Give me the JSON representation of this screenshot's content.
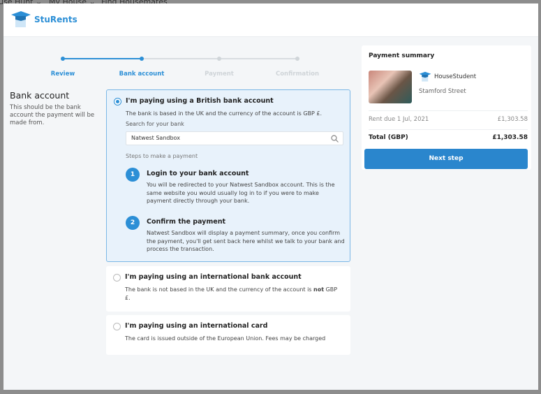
{
  "background_nav": [
    "use Hunt ⌄",
    "My House ⌄",
    "Find Housemates"
  ],
  "brand": {
    "name": "StuRents",
    "accent": "#2c8fd6"
  },
  "stepper": {
    "steps": [
      {
        "label": "Review",
        "state": "done"
      },
      {
        "label": "Bank account",
        "state": "current"
      },
      {
        "label": "Payment",
        "state": "pending"
      },
      {
        "label": "Confirmation",
        "state": "pending"
      }
    ]
  },
  "section": {
    "title": "Bank account",
    "description": "This should be the bank account the payment will be made from."
  },
  "options": [
    {
      "title": "I'm paying using a British bank account",
      "description": "The bank is based in the UK and the currency of the account is GBP £.",
      "selected": true,
      "search_label": "Search for your bank",
      "search_value": "Natwest Sandbox",
      "steps_label": "Steps to make a payment",
      "steps": [
        {
          "number": "1",
          "title": "Login to your bank account",
          "description": "You will be redirected to your Natwest Sandbox account. This is the same website you would usually log in to if you were to make payment directly through your bank."
        },
        {
          "number": "2",
          "title": "Confirm the payment",
          "description": "Natwest Sandbox will display a payment summary, once you confirm the payment, you'll get sent back here whilst we talk to your bank and process the transaction."
        }
      ]
    },
    {
      "title": "I'm paying using an international bank account",
      "description_pre": "The bank is not based in the UK and the currency of the account is ",
      "description_bold": "not",
      "description_post": " GBP £.",
      "selected": false
    },
    {
      "title": "I'm paying using an international card",
      "description": "The card is issued outside of the European Union. Fees may be charged",
      "selected": false
    }
  ],
  "summary": {
    "title": "Payment summary",
    "agent": "HouseStudent",
    "property": "Stamford Street",
    "rent_label": "Rent due 1 Jul, 2021",
    "rent_amount": "£1,303.58",
    "total_label": "Total (GBP)",
    "total_amount": "£1,303.58",
    "next_button": "Next step"
  }
}
